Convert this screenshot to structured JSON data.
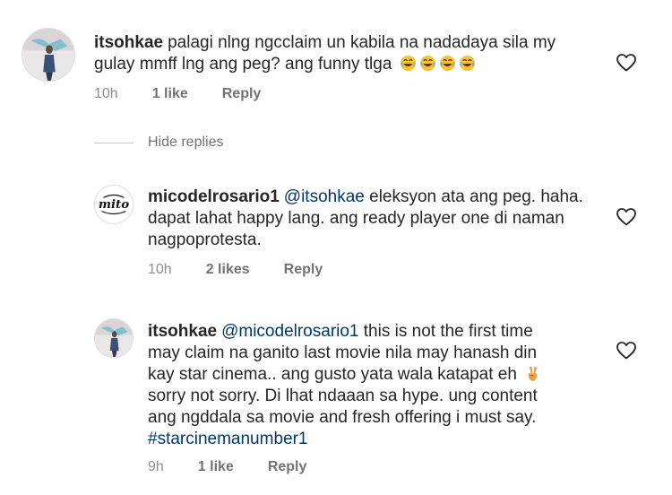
{
  "comments": [
    {
      "username": "itsohkae",
      "text": "palagi nlng ngcclaim un kabila na nadadaya sila my gulay mmff lng ang peg? ang funny tlga",
      "emoji_count": 4,
      "emoji_name": "laughing-face-emoji",
      "time": "10h",
      "likes": "1 like",
      "reply": "Reply"
    },
    {
      "username": "micodelrosario1",
      "mention": "@itsohkae",
      "text": "eleksyon ata ang peg. haha. dapat lahat happy lang. ang ready player one di naman nagpoprotesta.",
      "time": "10h",
      "likes": "2 likes",
      "reply": "Reply"
    },
    {
      "username": "itsohkae",
      "mention": "@micodelrosario1",
      "line1": "this is not the first time",
      "line2": "may claim na ganito last movie nila may hanash din",
      "line3": "kay star cinema.. ang gusto yata wala katapat eh",
      "line4": "sorry not sorry. Di lhat ndaaan sa hype.  ung content",
      "line5": "ang ngddala sa movie and fresh offering i must say.",
      "hashtag": "#starcinemanumber1",
      "emoji_name": "victory-hand-emoji",
      "time": "9h",
      "likes": "1 like",
      "reply": "Reply"
    }
  ],
  "hide_replies": "Hide replies",
  "colors": {
    "text": "#262626",
    "secondary": "#737373",
    "link": "#00376b",
    "divider": "#c7c7c7"
  }
}
